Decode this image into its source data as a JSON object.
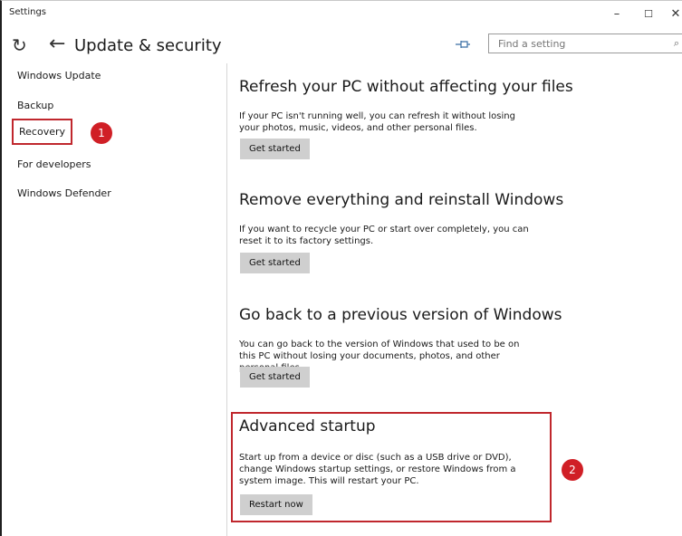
{
  "window": {
    "title": "Settings",
    "minimize_glyph": "–",
    "maximize_glyph": "☐",
    "close_glyph": "✕"
  },
  "header": {
    "page_title": "Update & security",
    "search_placeholder": "Find a setting"
  },
  "sidebar": {
    "items": [
      {
        "label": "Windows Update"
      },
      {
        "label": "Backup"
      },
      {
        "label": "Recovery"
      },
      {
        "label": "For developers"
      },
      {
        "label": "Windows Defender"
      }
    ]
  },
  "annotations": {
    "badge1": "1",
    "badge2": "2",
    "highlight_color": "#c0272d"
  },
  "sections": [
    {
      "title": "Refresh your PC without affecting your files",
      "description": "If your PC isn't running well, you can refresh it without losing your photos, music, videos, and other personal files.",
      "button": "Get started"
    },
    {
      "title": "Remove everything and reinstall Windows",
      "description": "If you want to recycle your PC or start over completely, you can reset it to its factory settings.",
      "button": "Get started"
    },
    {
      "title": "Go back to a previous version of Windows",
      "description": "You can go back to the version of Windows that used to be on this PC without losing your documents, photos, and other personal files.",
      "button": "Get started"
    },
    {
      "title": "Advanced startup",
      "description": "Start up from a device or disc (such as a USB drive or DVD), change Windows startup settings, or restore Windows from a system image. This will restart your PC.",
      "button": "Restart now"
    }
  ],
  "icons": {
    "refresh": "refresh-icon",
    "back": "back-arrow-icon",
    "pin": "pin-icon",
    "search": "search-icon"
  }
}
